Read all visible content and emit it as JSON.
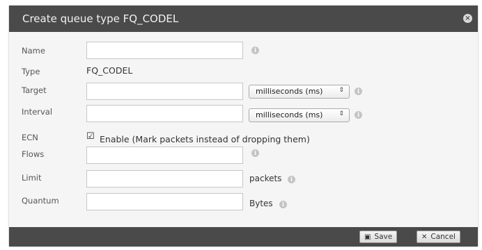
{
  "dialog": {
    "title": "Create queue type FQ_CODEL",
    "close_glyph": "×"
  },
  "form": {
    "name": {
      "label": "Name",
      "value": ""
    },
    "type": {
      "label": "Type",
      "value": "FQ_CODEL"
    },
    "target": {
      "label": "Target",
      "value": "",
      "unit_selected": "milliseconds (ms)"
    },
    "interval": {
      "label": "Interval",
      "value": "",
      "unit_selected": "milliseconds (ms)"
    },
    "ecn": {
      "label": "ECN",
      "checked": true,
      "checkbox_label": "Enable (Mark packets instead of dropping them)"
    },
    "flows": {
      "label": "Flows",
      "value": ""
    },
    "limit": {
      "label": "Limit",
      "value": "",
      "unit": "packets"
    },
    "quantum": {
      "label": "Quantum",
      "value": "",
      "unit": "Bytes"
    }
  },
  "info_glyph": "i",
  "select_arrow_glyph": "⇕",
  "checkbox_glyph": "☑",
  "footer": {
    "save_label": "Save",
    "save_icon": "floppy-disk-icon",
    "cancel_label": "Cancel",
    "cancel_icon": "x-icon"
  },
  "colors": {
    "titlebar": "#4a4a4a",
    "dialog_bg": "#f5f5f5",
    "info_icon": "#c4c4c4"
  }
}
